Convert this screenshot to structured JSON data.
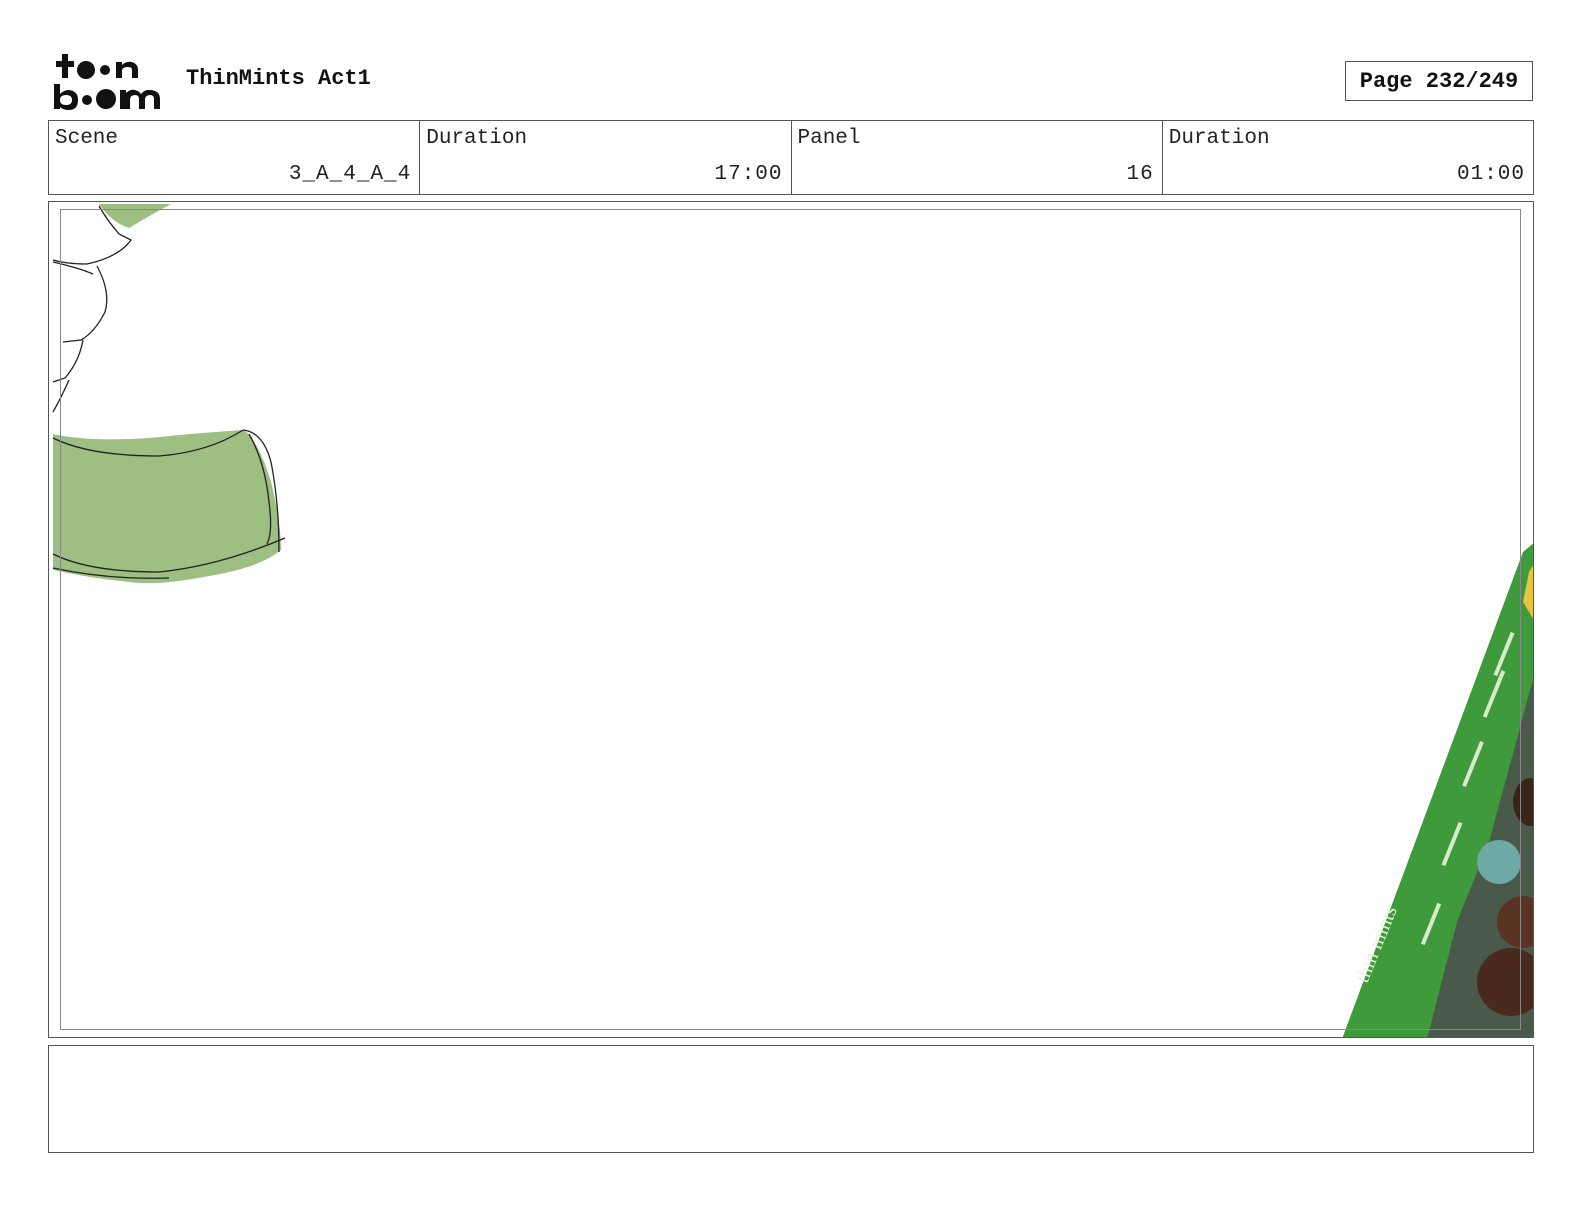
{
  "header": {
    "logo_text": "toon boom",
    "project_title": "ThinMints Act1",
    "page_label": "Page 232/249"
  },
  "info": {
    "scene_label": "Scene",
    "scene_value": "3_A_4_A_4",
    "scene_duration_label": "Duration",
    "scene_duration_value": "17:00",
    "panel_label": "Panel",
    "panel_value": "16",
    "panel_duration_label": "Duration",
    "panel_duration_value": "01:00"
  },
  "panel": {
    "sketch_color": "#9dbf82",
    "box_color": "#3f9a3c",
    "box_text": "thin mints"
  },
  "notes": {
    "text": ""
  }
}
